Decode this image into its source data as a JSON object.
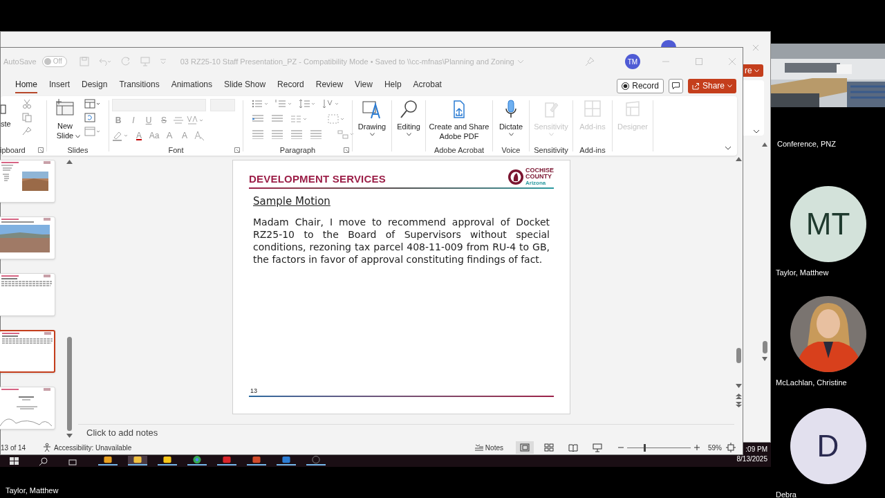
{
  "shared_screen": {
    "background_window": {
      "share_button": "re"
    },
    "powerpoint": {
      "autosave": {
        "label": "AutoSave",
        "on": false,
        "state": "Off"
      },
      "title": "03 RZ25-10 Staff Presentation_PZ  -  Compatibility Mode • Saved to \\\\cc-mfnas\\Planning and Zoning",
      "user_initials": "TM",
      "tabs": [
        {
          "label": "Home",
          "selected": true
        },
        {
          "label": "Insert",
          "selected": false
        },
        {
          "label": "Design",
          "selected": false
        },
        {
          "label": "Transitions",
          "selected": false
        },
        {
          "label": "Animations",
          "selected": false
        },
        {
          "label": "Slide Show",
          "selected": false
        },
        {
          "label": "Record",
          "selected": false
        },
        {
          "label": "Review",
          "selected": false
        },
        {
          "label": "View",
          "selected": false
        },
        {
          "label": "Help",
          "selected": false
        },
        {
          "label": "Acrobat",
          "selected": false
        }
      ],
      "record_button": "Record",
      "share_button": "Share",
      "ribbon": [
        {
          "kind": "clipboard",
          "label": "ipboard",
          "paste_label": "ste"
        },
        {
          "kind": "slides",
          "label": "Slides",
          "new_slide_label": "New Slide"
        },
        {
          "kind": "font",
          "label": "Font",
          "glyphs": [
            "B",
            "I",
            "U",
            "S",
            "A",
            "Aa",
            "A",
            "A"
          ]
        },
        {
          "kind": "paragraph",
          "label": "Paragraph"
        },
        {
          "kind": "large",
          "buttons": [
            {
              "label": "Drawing",
              "kind": "drawing",
              "disabled": false,
              "dropdown": true
            }
          ]
        },
        {
          "kind": "large",
          "buttons": [
            {
              "label": "Editing",
              "kind": "search",
              "disabled": false,
              "dropdown": true
            }
          ]
        },
        {
          "kind": "large",
          "label": "Adobe Acrobat",
          "buttons": [
            {
              "label": "Create and Share Adobe PDF",
              "kind": "pdf",
              "disabled": false,
              "dropdown": false
            }
          ]
        },
        {
          "kind": "large",
          "label": "Voice",
          "buttons": [
            {
              "label": "Dictate",
              "kind": "mic",
              "disabled": false,
              "dropdown": true
            }
          ]
        },
        {
          "kind": "large",
          "label": "Sensitivity",
          "buttons": [
            {
              "label": "Sensitivity",
              "kind": "sensitivity",
              "disabled": true,
              "dropdown": true
            }
          ]
        },
        {
          "kind": "large",
          "label": "Add-ins",
          "buttons": [
            {
              "label": "Add-ins",
              "kind": "addins",
              "disabled": true,
              "dropdown": false
            }
          ]
        },
        {
          "kind": "large",
          "buttons": [
            {
              "label": "Designer",
              "kind": "designer",
              "disabled": true,
              "dropdown": false
            }
          ]
        }
      ],
      "thumbnails": [
        {
          "kind": "text-picture",
          "selected": false
        },
        {
          "kind": "picture",
          "selected": false
        },
        {
          "kind": "text",
          "selected": false
        },
        {
          "kind": "text",
          "selected": true
        },
        {
          "kind": "title-chart",
          "selected": false
        }
      ],
      "slide": {
        "header": "DEVELOPMENT SERVICES",
        "logo": [
          "COCHISE",
          "COUNTY",
          "Arizona"
        ],
        "title": "Sample Motion",
        "body": "Madam Chair, I move to recommend approval of Docket RZ25-10 to the Board of Supervisors without special conditions, rezoning tax parcel 408-11-009 from RU-4 to GB, the factors in favor of approval constituting findings of fact.",
        "number": "13"
      },
      "notes": {
        "placeholder": "Click to add notes"
      },
      "status_bar": {
        "slide_counter": "13 of 14",
        "accessibility": "Accessibility: Unavailable",
        "notes_button": "Notes",
        "views": [
          {
            "kind": "normal",
            "selected": true
          },
          {
            "kind": "sorter",
            "selected": false
          },
          {
            "kind": "reading",
            "selected": false
          },
          {
            "kind": "slideshow",
            "selected": false
          }
        ],
        "zoom": {
          "level": 0.27,
          "reading": "59%"
        }
      }
    },
    "taskbar": {
      "apps": [
        {
          "kind": "files",
          "selected": false
        },
        {
          "kind": "app",
          "selected": true
        },
        {
          "kind": "explorer",
          "selected": false
        },
        {
          "kind": "chrome",
          "selected": false
        },
        {
          "kind": "acrobat",
          "selected": false
        },
        {
          "kind": "powerpoint",
          "selected": false
        },
        {
          "kind": "outlook",
          "selected": false
        },
        {
          "kind": "media",
          "selected": false
        }
      ],
      "time": ":09 PM",
      "date": "8/13/2025"
    }
  },
  "participants": [
    {
      "name": "Conference, PNZ",
      "kind": "video"
    },
    {
      "name": "Taylor, Matthew",
      "kind": "initials",
      "initials": "MT",
      "color": "#d3e2da"
    },
    {
      "name": "McLachlan, Christine"
    },
    {
      "name": "Debra",
      "kind": "initials",
      "initials": "D",
      "color": "#e2e0ee"
    }
  ],
  "presenter": "Taylor, Matthew"
}
